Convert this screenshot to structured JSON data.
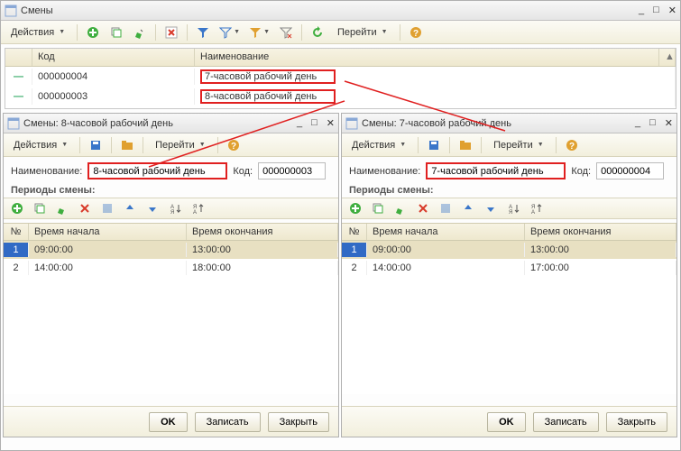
{
  "main": {
    "title": "Смены",
    "actions_label": "Действия",
    "list": {
      "headers": {
        "code": "Код",
        "name": "Наименование"
      },
      "rows": [
        {
          "code": "000000004",
          "name": "7-часовой рабочий день"
        },
        {
          "code": "000000003",
          "name": "8-часовой рабочий день"
        }
      ]
    }
  },
  "sub": {
    "actions_label": "Действия",
    "goto_label": "Перейти",
    "name_label": "Наименование:",
    "code_label": "Код:",
    "periods_label": "Периоды смены:",
    "pt_headers": {
      "num": "№",
      "start": "Время начала",
      "end": "Время окончания"
    },
    "left": {
      "title": "Смены: 8-часовой рабочий день",
      "name": "8-часовой рабочий день",
      "code": "000000003",
      "rows": [
        {
          "num": "1",
          "start": "09:00:00",
          "end": "13:00:00"
        },
        {
          "num": "2",
          "start": "14:00:00",
          "end": "18:00:00"
        }
      ]
    },
    "right": {
      "title": "Смены: 7-часовой рабочий день",
      "name": "7-часовой рабочий день",
      "code": "000000004",
      "rows": [
        {
          "num": "1",
          "start": "09:00:00",
          "end": "13:00:00"
        },
        {
          "num": "2",
          "start": "14:00:00",
          "end": "17:00:00"
        }
      ]
    }
  },
  "footer": {
    "ok": "OK",
    "save": "Записать",
    "close": "Закрыть"
  },
  "icons": {
    "grid": "grid-icon",
    "add": "plus-icon",
    "copy": "copy-icon",
    "edit": "pencil-icon",
    "del": "delete-icon",
    "mark": "mark-icon",
    "filter": "filter-icon",
    "filter2": "filter2-icon",
    "clear": "clear-filter-icon",
    "refresh": "refresh-icon",
    "goto": "arrow-right-icon",
    "help": "help-icon",
    "save": "save-icon",
    "up": "up-icon",
    "down": "down-icon",
    "sortA": "sort-asc-icon",
    "sortD": "sort-desc-icon",
    "folder": "folder-icon"
  }
}
